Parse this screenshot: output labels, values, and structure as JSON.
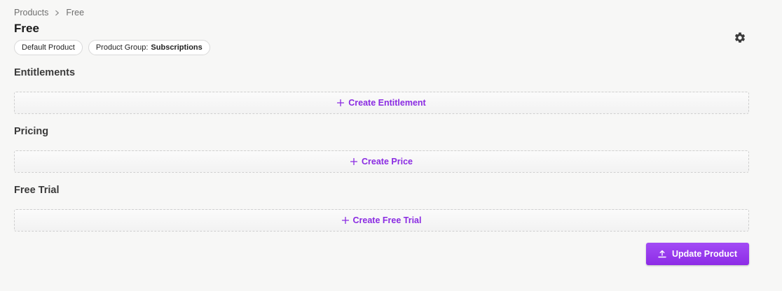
{
  "breadcrumb": {
    "items": [
      "Products",
      "Free"
    ]
  },
  "page": {
    "title": "Free"
  },
  "badges": {
    "default_product": "Default Product",
    "product_group_label": "Product Group:",
    "product_group_value": "Subscriptions"
  },
  "sections": {
    "entitlements": {
      "title": "Entitlements",
      "action_label": "Create Entitlement"
    },
    "pricing": {
      "title": "Pricing",
      "action_label": "Create Price"
    },
    "free_trial": {
      "title": "Free Trial",
      "action_label": "Create Free Trial"
    }
  },
  "footer": {
    "update_label": "Update Product"
  },
  "colors": {
    "accent": "#8a2be2",
    "button_bg": "#9b3ef0",
    "background": "#f7f7f6"
  },
  "icons": {
    "settings": "gear-icon",
    "breadcrumb_separator": "chevron-right-icon",
    "add": "plus-icon",
    "update": "upload-icon"
  }
}
